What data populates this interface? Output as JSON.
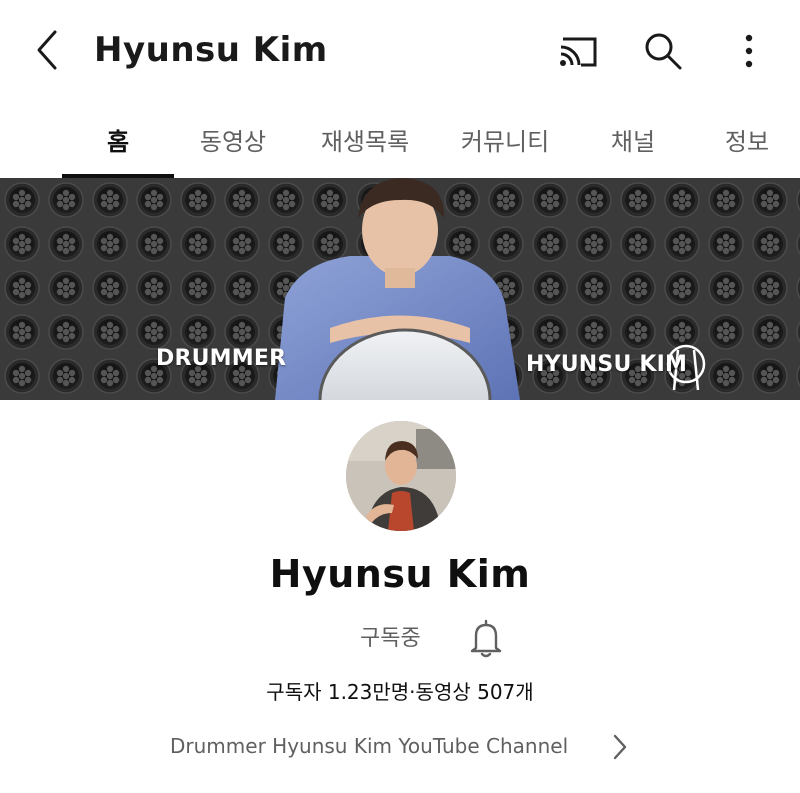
{
  "header": {
    "title": "Hyunsu Kim",
    "icons": [
      "back-arrow-icon",
      "cast-icon",
      "search-icon",
      "more-vert-icon"
    ]
  },
  "tabs": [
    {
      "label": "홈",
      "active": true
    },
    {
      "label": "동영상",
      "active": false
    },
    {
      "label": "재생목록",
      "active": false
    },
    {
      "label": "커뮤니티",
      "active": false
    },
    {
      "label": "채널",
      "active": false
    },
    {
      "label": "정보",
      "active": false
    }
  ],
  "banner": {
    "left_text": "DRUMMER",
    "right_text": "HYUNSU KIM"
  },
  "channel": {
    "name": "Hyunsu Kim",
    "subscribe_label": "구독중",
    "stats": "구독자 1.23만명·동영상 507개",
    "description": "Drummer Hyunsu Kim YouTube Channel"
  },
  "colors": {
    "text_primary": "#0f0f0f",
    "text_secondary": "#606060",
    "banner_bg": "#2b2b2b"
  }
}
